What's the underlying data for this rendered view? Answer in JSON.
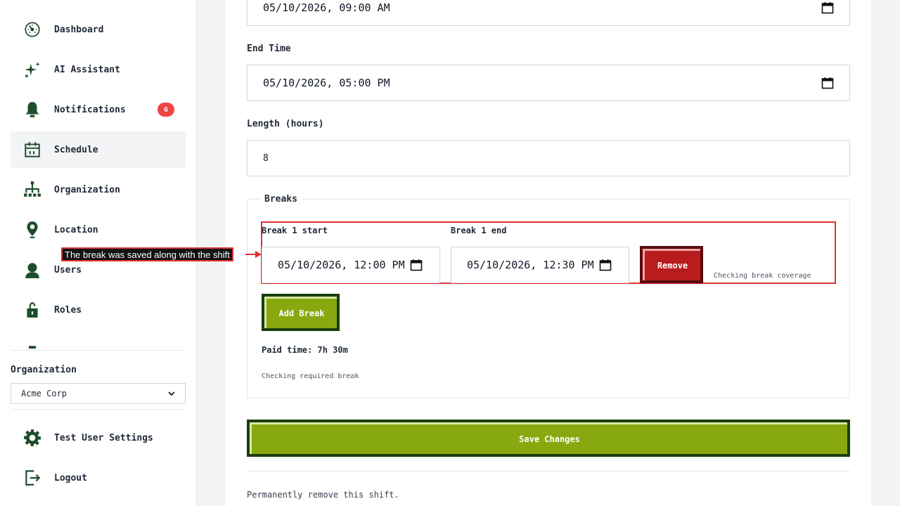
{
  "sidebar": {
    "items": [
      {
        "label": "Dashboard",
        "icon": "dashboard-gauge-icon"
      },
      {
        "label": "AI Assistant",
        "icon": "sparkle-icon"
      },
      {
        "label": "Notifications",
        "icon": "bell-icon",
        "badge": "6"
      },
      {
        "label": "Schedule",
        "icon": "calendar-icon",
        "active": true
      },
      {
        "label": "Organization",
        "icon": "org-chart-icon"
      },
      {
        "label": "Location",
        "icon": "map-pin-icon"
      },
      {
        "label": "Users",
        "icon": "user-icon"
      },
      {
        "label": "Roles",
        "icon": "lock-icon"
      }
    ],
    "organization_label": "Organization",
    "organization_value": "Acme Corp",
    "settings_label": "Test User Settings",
    "logout_label": "Logout"
  },
  "form": {
    "start_time_value": "05/10/2026, 09:00 AM",
    "end_time_label": "End Time",
    "end_time_value": "05/10/2026, 05:00 PM",
    "length_label": "Length (hours)",
    "length_value": "8",
    "breaks_legend": "Breaks",
    "break": {
      "start_label": "Break 1 start",
      "start_value": "05/10/2026, 12:00 PM",
      "end_label": "Break 1 end",
      "end_value": "05/10/2026, 12:30 PM",
      "remove_label": "Remove",
      "coverage_hint": "Checking break coverage"
    },
    "add_break_label": "Add Break",
    "paid_time": "Paid time: 7h 30m",
    "required_hint": "Checking required break",
    "save_label": "Save Changes",
    "delete_text": "Permanently remove this shift."
  },
  "annotation": {
    "text": "The break was saved along with the shift",
    "color": "#e03131"
  },
  "colors": {
    "accent_green": "#88a80f",
    "dark_green": "#1a3d0c",
    "danger_red": "#b91c1c",
    "badge_red": "#ef4444",
    "icon_green": "#1e4d2b"
  }
}
